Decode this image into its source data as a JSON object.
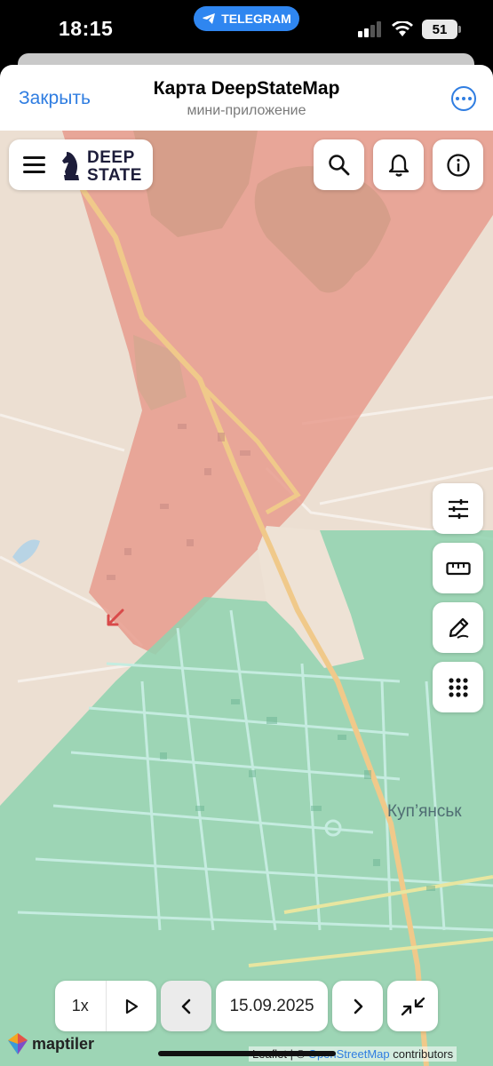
{
  "status_bar": {
    "time": "18:15",
    "telegram_pill": "TELEGRAM",
    "battery": "51"
  },
  "header": {
    "close_label": "Закрыть",
    "title": "Карта DeepStateMap",
    "subtitle": "мини-приложение"
  },
  "logo": {
    "line1": "DEEP",
    "line2": "STATE"
  },
  "map": {
    "city_label": "Куп’янськ",
    "attribution_prefix": "Leaflet | © ",
    "attribution_link": "OpenStreetMap",
    "attribution_suffix": " contributors",
    "maptiler_label": "maptiler",
    "colors": {
      "occupied": "#e79c8e",
      "liberated": "#8fd3b0",
      "background": "#ecdfd2"
    }
  },
  "controls": {
    "speed": "1x",
    "date": "15.09.2025"
  },
  "icons": {
    "menu": "hamburger-icon",
    "search": "search-icon",
    "bell": "bell-icon",
    "info": "info-icon",
    "filters": "sliders-icon",
    "ruler": "ruler-icon",
    "draw": "pen-icon",
    "grid": "grid-icon",
    "play": "play-icon",
    "prev": "chevron-left-icon",
    "next": "chevron-right-icon",
    "collapse": "collapse-arrows-icon"
  }
}
